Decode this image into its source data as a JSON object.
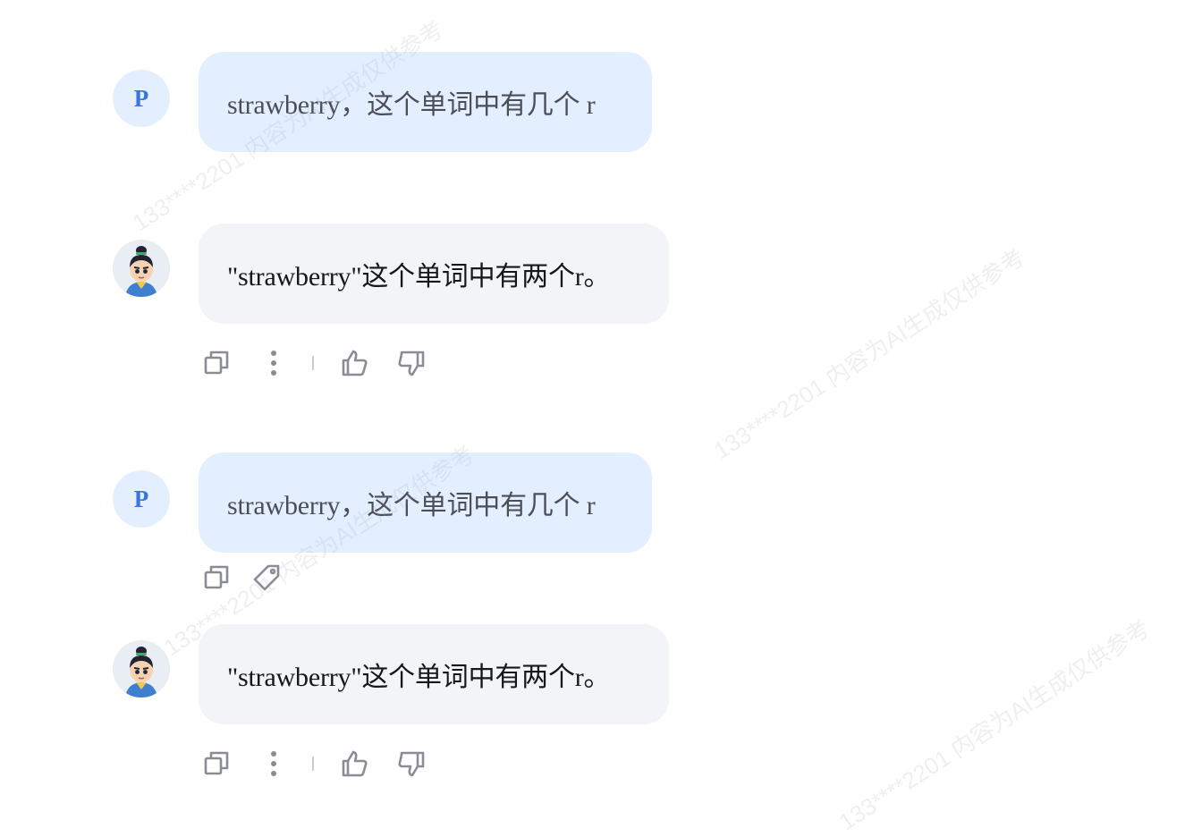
{
  "watermark": "133****2201 内容为AI生成仅供参考",
  "user_initial": "P",
  "messages": [
    {
      "role": "user",
      "text": "strawberry，这个单词中有几个 r"
    },
    {
      "role": "assistant",
      "text": "\"strawberry\"这个单词中有两个r。"
    },
    {
      "role": "user",
      "text": "strawberry，这个单词中有几个 r"
    },
    {
      "role": "assistant",
      "text": "\"strawberry\"这个单词中有两个r。"
    }
  ],
  "icons": {
    "copy": "copy-icon",
    "more": "more-vertical-icon",
    "like": "thumbs-up-icon",
    "dislike": "thumbs-down-icon",
    "tag": "tag-icon"
  },
  "colors": {
    "user_bubble": "#e3efff",
    "assistant_bubble": "#f3f4f8",
    "user_initial": "#3a72e0",
    "icon": "#8a8d96"
  }
}
